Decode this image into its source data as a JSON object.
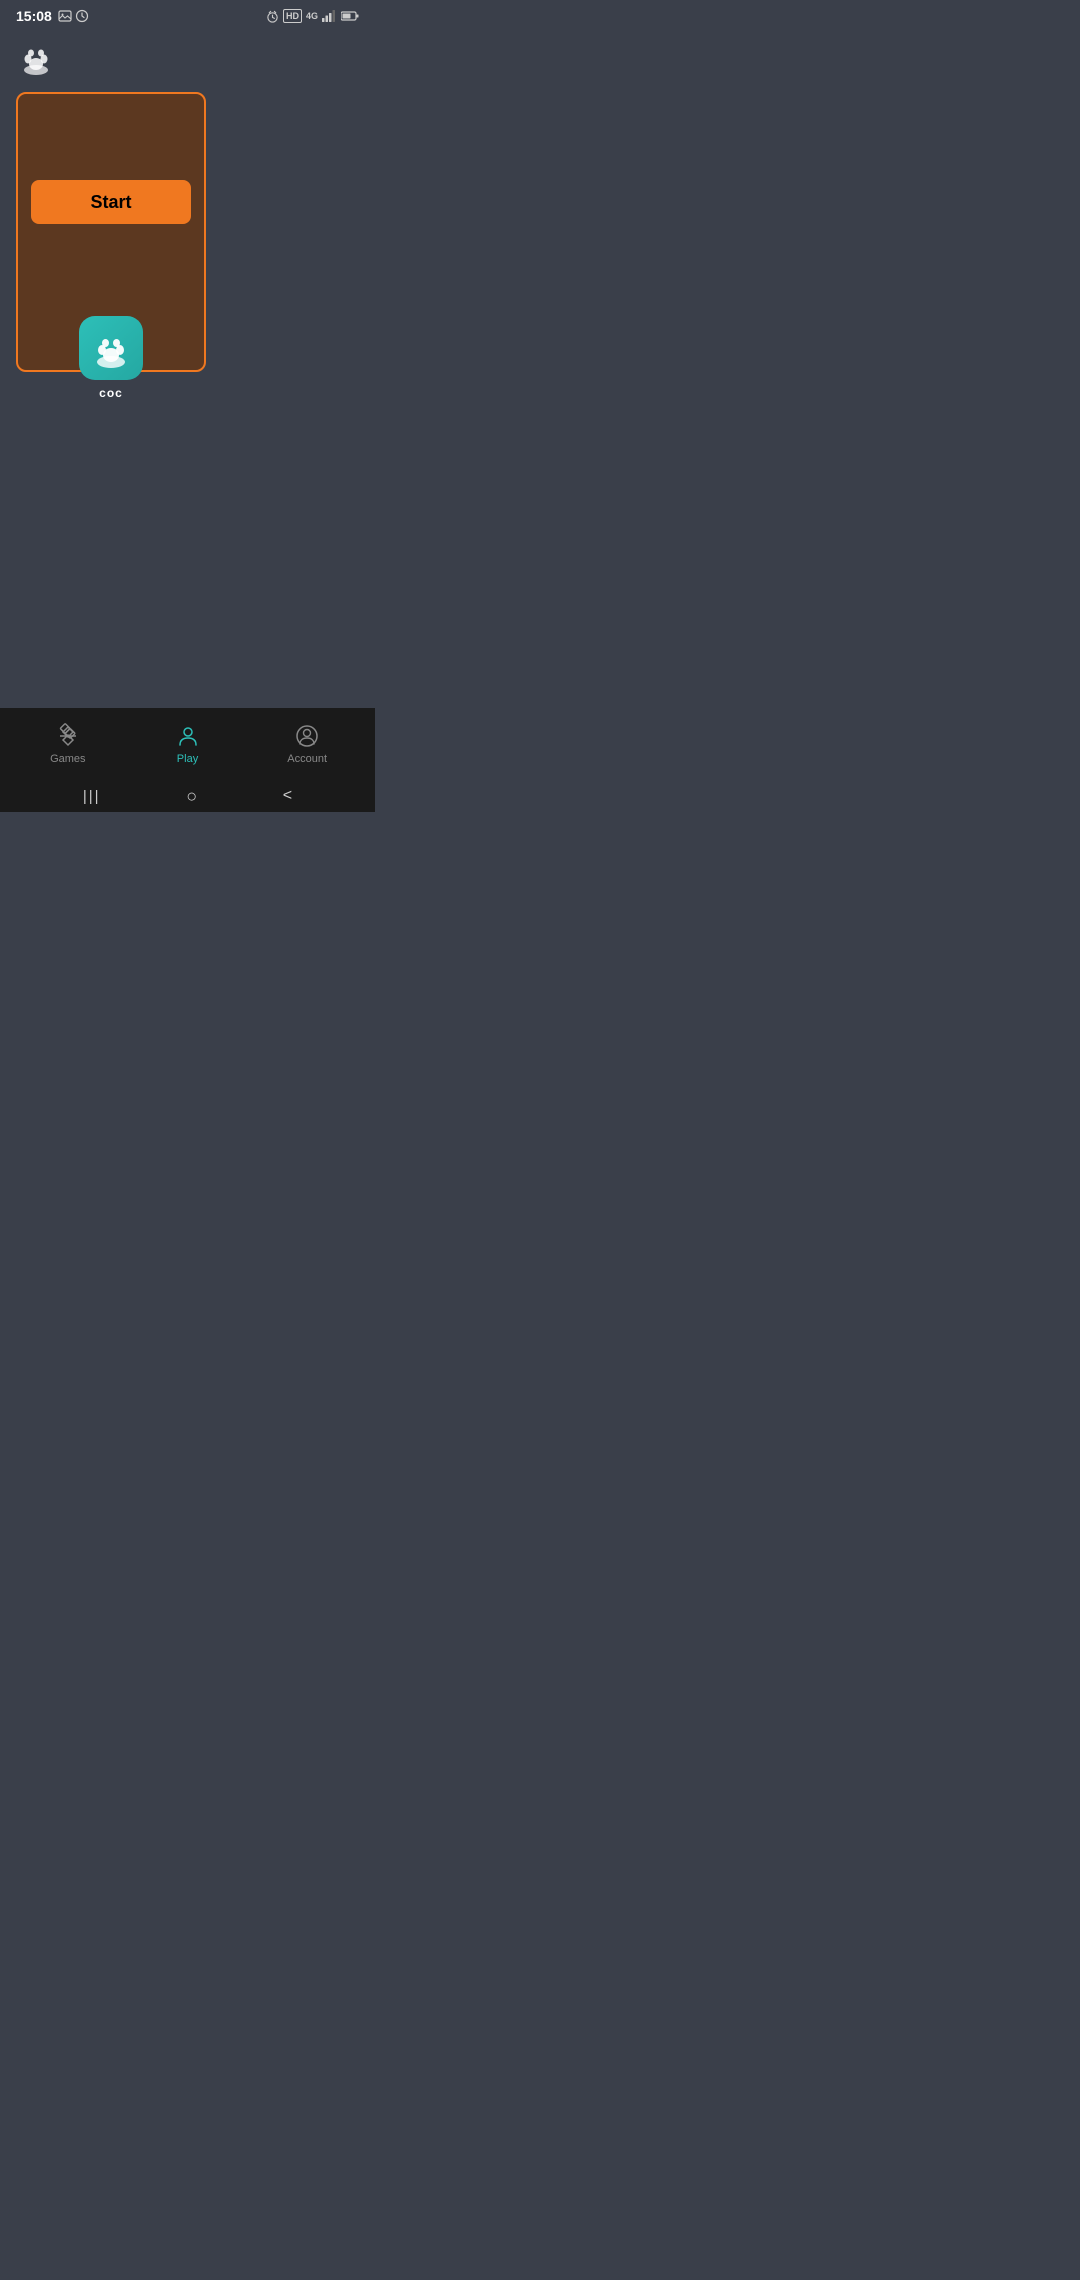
{
  "statusBar": {
    "time": "15:08",
    "leftIcons": [
      "image-icon",
      "clock-icon"
    ],
    "rightIcons": [
      "alarm-icon",
      "hd-label",
      "4g-label",
      "signal-icon",
      "battery-icon"
    ],
    "hdLabel": "HD",
    "networkLabel": "4G"
  },
  "header": {
    "appIcon": "paw-cloud-icon"
  },
  "gameCard": {
    "startButtonLabel": "Start",
    "appIconLabel": "coc"
  },
  "bottomNav": {
    "items": [
      {
        "id": "games",
        "label": "Games",
        "active": false
      },
      {
        "id": "play",
        "label": "Play",
        "active": true
      },
      {
        "id": "account",
        "label": "Account",
        "active": false
      }
    ]
  },
  "systemNav": {
    "recentAppsLabel": "|||",
    "homeLabel": "○",
    "backLabel": "<"
  }
}
